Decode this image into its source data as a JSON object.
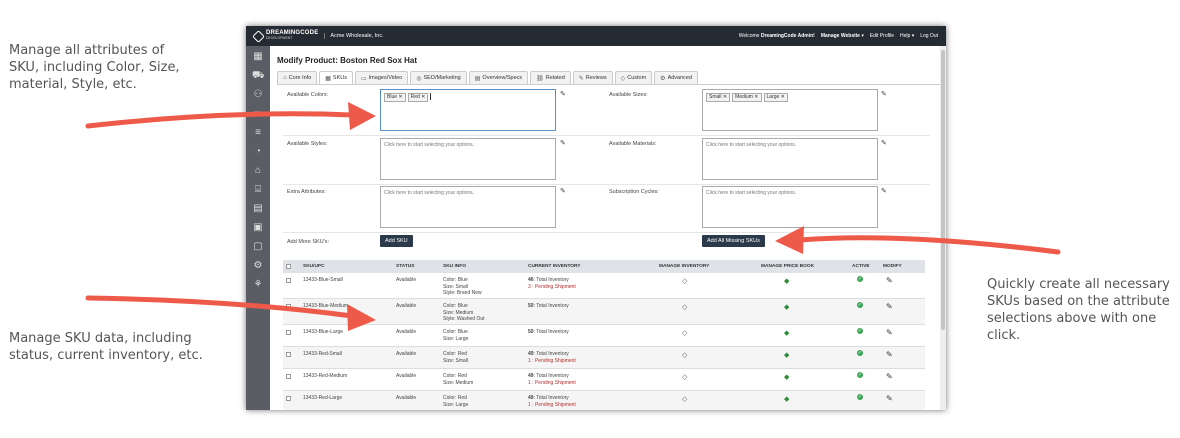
{
  "callouts": {
    "attributes": [
      "Manage all attributes of",
      "SKU, including Color, Size,",
      "material, Style, etc."
    ],
    "sku_data": [
      "Manage SKU data, including",
      "status, current inventory, etc."
    ],
    "create_skus": [
      "Quickly create all necessary",
      "SKUs based on the attribute",
      "selections above with one",
      "click."
    ]
  },
  "app": {
    "logo": "DREAMINGCODE",
    "logo_sub": "DEVELOPMENT",
    "company": "Acme Wholesale, Inc.",
    "welcome_prefix": "Welcome",
    "welcome_user": "DreamingCode Admin!",
    "nav": {
      "manage_website": "Manage Website ▾",
      "edit_profile": "Edit Profile",
      "help": "Help ▾",
      "logout": "Log Out"
    }
  },
  "page": {
    "title": "Modify Product: Boston Red Sox Hat",
    "tabs": [
      {
        "label": "Core Info",
        "icon": "tag-icon"
      },
      {
        "label": "SKUs",
        "icon": "grid-icon"
      },
      {
        "label": "Images/Video",
        "icon": "image-icon"
      },
      {
        "label": "SEO/Marketing",
        "icon": "target-icon"
      },
      {
        "label": "Overview/Specs",
        "icon": "doc-icon"
      },
      {
        "label": "Related",
        "icon": "link-icon"
      },
      {
        "label": "Reviews",
        "icon": "pencil-icon"
      },
      {
        "label": "Custom",
        "icon": "tag-icon"
      },
      {
        "label": "Advanced",
        "icon": "gear-icon"
      }
    ]
  },
  "attributes": {
    "colors_label": "Available Colors:",
    "colors": [
      "Blue",
      "Red"
    ],
    "sizes_label": "Available Sizes:",
    "sizes": [
      "Small",
      "Medium",
      "Large"
    ],
    "styles_label": "Available Styles:",
    "materials_label": "Available Materials:",
    "extra_label": "Extra Attributes:",
    "subscription_label": "Subscription Cycles:",
    "placeholder": "Click here to start selecting your options.",
    "add_more_label": "Add More SKU's:",
    "add_sku_button": "Add SKU",
    "add_missing_button": "Add All Missing SKUs"
  },
  "table": {
    "headers": {
      "sku": "SKU/UPC",
      "status": "STATUS",
      "info": "SKU INFO",
      "inventory": "CURRENT INVENTORY",
      "manage_inventory": "MANAGE INVENTORY",
      "price_book": "MANAGE PRICE BOOK",
      "active": "ACTIVE",
      "modify": "MODIFY"
    },
    "rows": [
      {
        "sku": "13433-Blue-Small",
        "status": "Available",
        "info": [
          "Color: Blue",
          "Size: Small",
          "Style: Brand New"
        ],
        "total": "46",
        "total_label": ": Total Inventory",
        "pending": "3 : Pending Shipment"
      },
      {
        "sku": "13433-Blue-Medium",
        "status": "Available",
        "info": [
          "Color: Blue",
          "Size: Medium",
          "Style: Washed Out"
        ],
        "total": "50",
        "total_label": ": Total Inventory",
        "pending": ""
      },
      {
        "sku": "13433-Blue-Large",
        "status": "Available",
        "info": [
          "Color: Blue",
          "Size: Large"
        ],
        "total": "50",
        "total_label": ": Total Inventory",
        "pending": ""
      },
      {
        "sku": "13433-Red-Small",
        "status": "Available",
        "info": [
          "Color: Red",
          "Size: Small"
        ],
        "total": "49",
        "total_label": ": Total Inventory",
        "pending": "1 : Pending Shipment"
      },
      {
        "sku": "13433-Red-Medium",
        "status": "Available",
        "info": [
          "Color: Red",
          "Size: Medium"
        ],
        "total": "49",
        "total_label": ": Total Inventory",
        "pending": "1 : Pending Shipment"
      },
      {
        "sku": "13433-Red-Large",
        "status": "Available",
        "info": [
          "Color: Red",
          "Size: Large"
        ],
        "total": "49",
        "total_label": ": Total Inventory",
        "pending": "1 : Pending Shipment"
      }
    ]
  },
  "colors": {
    "arrow": "#ee5a4a",
    "topbar": "#252b33",
    "sidebar": "#5a5d63",
    "button": "#2b3a4b",
    "pending": "#b0302a",
    "active": "#3aa655"
  }
}
